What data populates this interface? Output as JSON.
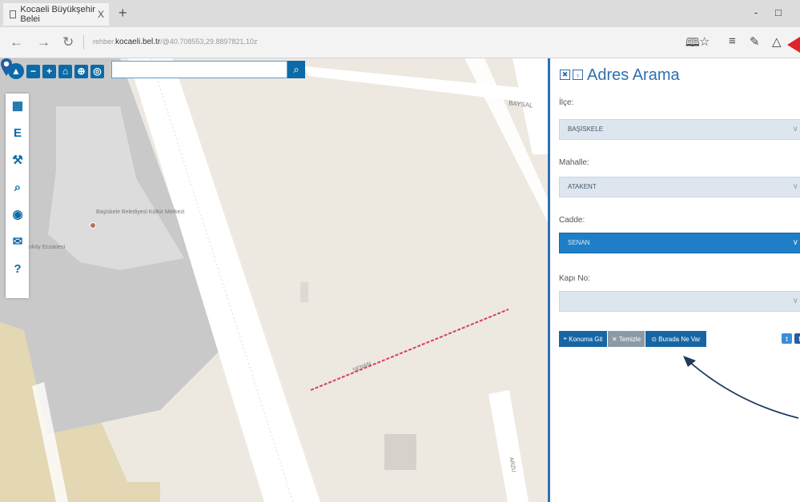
{
  "browser": {
    "tab_title": "Kocaeli Büyükşehir Belei",
    "tab_close": "X",
    "new_tab": "+",
    "minimize": "-",
    "maximize": "⃞",
    "url_prefix": "rehber.",
    "url_domain": "kocaeli.bel.tr",
    "url_rest": "/@40.708553,29.8897821,10z"
  },
  "map": {
    "search_placeholder": "",
    "labels": {
      "baysal": "BAYSAL",
      "kultur_merkezi": "Başiskele Belediyesi Kültür Merkezi",
      "eczane": "nköy Eczanesi",
      "senan": "SENAN",
      "arzu": "ARZU"
    },
    "accent_color": "#0d6aa8"
  },
  "panel": {
    "title": "Adres Arama",
    "fields": {
      "ilce_label": "İlçe:",
      "ilce_value": "BAŞİSKELE",
      "mahalle_label": "Mahalle:",
      "mahalle_value": "ATAKENT",
      "cadde_label": "Cadde:",
      "cadde_value": "SENAN",
      "kapi_label": "Kapı No:",
      "kapi_value": ""
    },
    "buttons": {
      "konuma_git": "Konuma Git",
      "temizle": "Temizle",
      "burada_ne_var": "Burada Ne Var"
    },
    "social": {
      "twitter": "t",
      "facebook": "f"
    }
  }
}
